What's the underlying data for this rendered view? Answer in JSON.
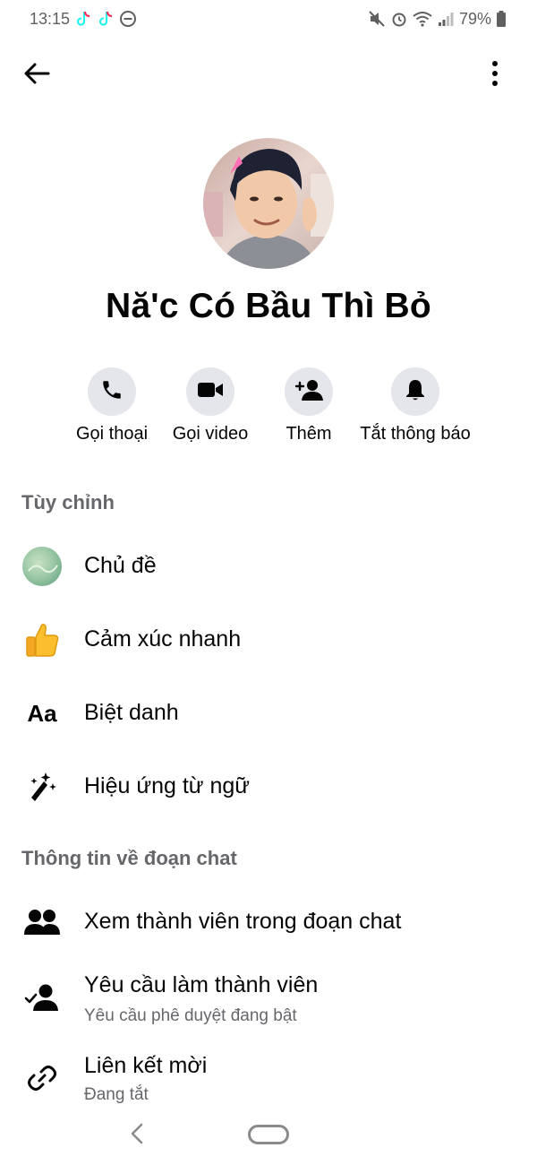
{
  "status_bar": {
    "time": "13:15",
    "battery": "79%"
  },
  "profile": {
    "name": "Nă'c Có Bầu Thì Bỏ"
  },
  "actions": [
    {
      "label": "Gọi thoại",
      "icon": "phone-icon"
    },
    {
      "label": "Gọi video",
      "icon": "video-icon"
    },
    {
      "label": "Thêm",
      "icon": "add-person-icon"
    },
    {
      "label": "Tắt thông báo",
      "icon": "bell-icon"
    }
  ],
  "sections": {
    "customize": "Tùy chỉnh",
    "chat_info": "Thông tin về đoạn chat"
  },
  "customize_items": [
    {
      "label": "Chủ đề",
      "icon": "theme-icon"
    },
    {
      "label": "Cảm xúc nhanh",
      "icon": "thumbs-up-icon"
    },
    {
      "label": "Biệt danh",
      "icon": "nickname-icon",
      "glyph": "Aa"
    },
    {
      "label": "Hiệu ứng từ ngữ",
      "icon": "magic-wand-icon"
    }
  ],
  "chat_info_items": [
    {
      "label": "Xem thành viên trong đoạn chat",
      "icon": "members-icon"
    },
    {
      "label": "Yêu cầu làm thành viên",
      "sub": "Yêu cầu phê duyệt đang bật",
      "icon": "member-request-icon"
    },
    {
      "label": "Liên kết mời",
      "sub": "Đang tắt",
      "icon": "link-icon"
    }
  ],
  "colors": {
    "accent_circle": "#e4e6eb",
    "secondary_text": "#65676b",
    "primary_text": "#050505"
  }
}
